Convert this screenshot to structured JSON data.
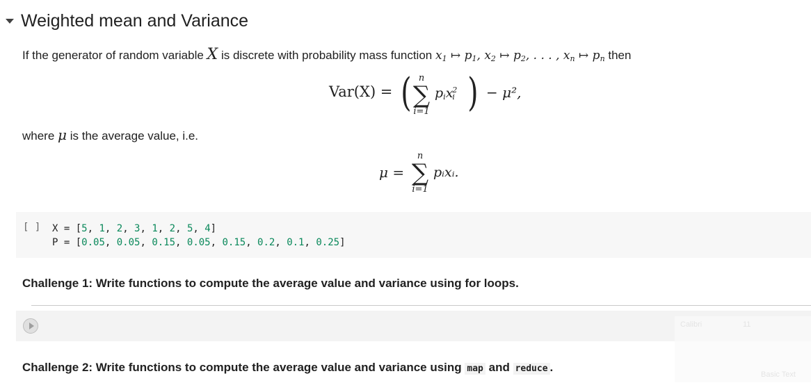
{
  "section": {
    "title": "Weighted mean and Variance"
  },
  "paragraph1": {
    "text_before": "If the generator of random variable ",
    "var_x": "X",
    "text_middle": " is discrete with probability mass function ",
    "text_end": " then"
  },
  "variance_eq": {
    "lhs": "Var(X) =",
    "upper": "n",
    "lower": "i=1",
    "rhs_tail": "− μ², "
  },
  "paragraph2": {
    "before": "where ",
    "mu": "μ",
    "after": " is the average value, i.e."
  },
  "mean_eq": {
    "lhs": "μ =",
    "upper": "n",
    "lower": "i=1",
    "term": "pᵢxᵢ."
  },
  "code_cell": {
    "bracket": "[ ]",
    "X": [
      5,
      1,
      2,
      3,
      1,
      2,
      5,
      4
    ],
    "P": [
      0.05,
      0.05,
      0.15,
      0.05,
      0.15,
      0.2,
      0.1,
      0.25
    ]
  },
  "challenge1": {
    "text": "Challenge 1: Write functions to compute the average value and variance using for loops."
  },
  "challenge2": {
    "before": "Challenge 2: Write functions to compute the average value and variance using ",
    "code1": "map",
    "middle": " and ",
    "code2": "reduce",
    "end": "."
  },
  "ghost_toolbar": {
    "font": "Calibri",
    "size": "11",
    "style": "Basic Text"
  }
}
